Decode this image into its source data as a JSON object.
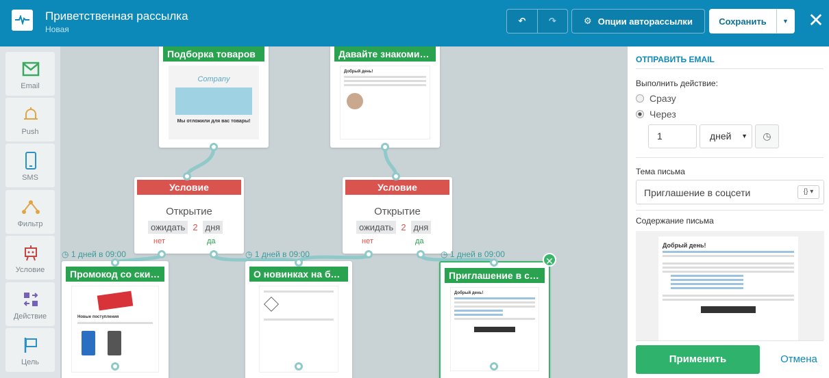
{
  "header": {
    "title": "Приветственная рассылка",
    "subtitle": "Новая",
    "options_label": "Опции авторассылки",
    "save_label": "Сохранить"
  },
  "toolbar": [
    {
      "label": "Email",
      "icon": "envelope-icon"
    },
    {
      "label": "Push",
      "icon": "bell-icon"
    },
    {
      "label": "SMS",
      "icon": "phone-icon"
    },
    {
      "label": "Фильтр",
      "icon": "filter-icon"
    },
    {
      "label": "Условие",
      "icon": "robot-icon"
    },
    {
      "label": "Действие",
      "icon": "action-icon"
    },
    {
      "label": "Цель",
      "icon": "flag-icon"
    }
  ],
  "canvas": {
    "cards": [
      {
        "title": "Подборка товаров",
        "company": "Company",
        "heading": "Мы отложили для вас товары!"
      },
      {
        "title": "Давайте знакомиться",
        "greeting": "Добрый день!"
      },
      {
        "title": "Промокод со скидкой",
        "section": "Новые поступления"
      },
      {
        "title": "О новинках на блоге"
      },
      {
        "title": "Приглашение в соцс...",
        "greeting": "Добрый день!"
      }
    ],
    "conditions": [
      {
        "title": "Условие",
        "event": "Открытие",
        "wait_label": "ожидать",
        "wait_value": "2",
        "wait_unit": "дня",
        "no": "нет",
        "yes": "да"
      },
      {
        "title": "Условие",
        "event": "Открытие",
        "wait_label": "ожидать",
        "wait_value": "2",
        "wait_unit": "дня",
        "no": "нет",
        "yes": "да"
      }
    ],
    "delays": [
      "1 дней в 09:00",
      "1 дней в 09:00",
      "1 дней в 09:00"
    ]
  },
  "panel": {
    "heading": "ОТПРАВИТЬ EMAIL",
    "action_label": "Выполнить действие:",
    "option_now": "Сразу",
    "option_after": "Через",
    "selected_option": "Через",
    "delay_value": "1",
    "delay_unit": "дней",
    "subject_label": "Тема письма",
    "subject_value": "Приглашение в соцсети",
    "content_label": "Содержание письма",
    "preview_greeting": "Добрый день!",
    "apply_label": "Применить",
    "cancel_label": "Отмена"
  },
  "colors": {
    "header": "#0d89b9",
    "card_title": "#29a34f",
    "condition_title": "#d9534f",
    "apply": "#2fb36c"
  }
}
